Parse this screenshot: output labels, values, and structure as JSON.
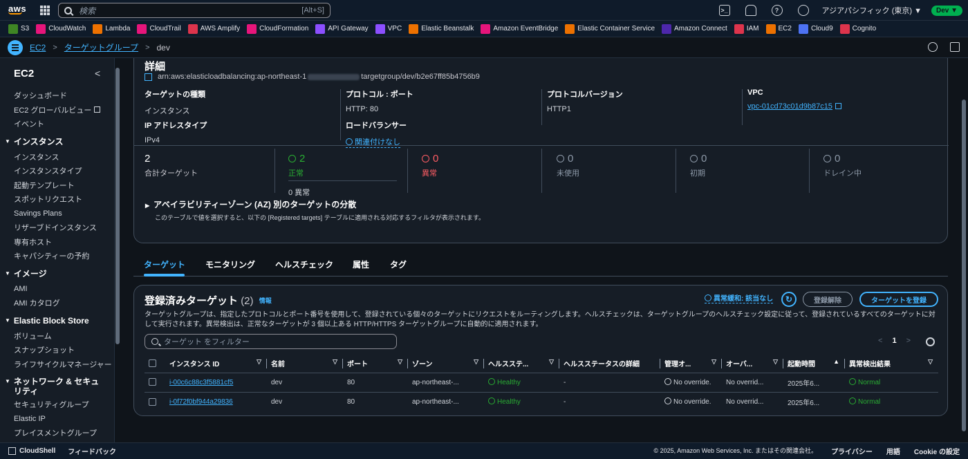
{
  "topbar": {
    "logo": "aws",
    "search_placeholder": "検索",
    "search_shortcut": "[Alt+S]",
    "region": "アジアパシフィック (東京) ▼",
    "account": "Dev ▼",
    "icons": [
      "cloudshell-icon",
      "bell-icon",
      "help-icon",
      "gear-icon"
    ]
  },
  "favorites": [
    {
      "label": "S3",
      "color": "#3f8624"
    },
    {
      "label": "CloudWatch",
      "color": "#e7157b"
    },
    {
      "label": "Lambda",
      "color": "#ed7100"
    },
    {
      "label": "CloudTrail",
      "color": "#e7157b"
    },
    {
      "label": "AWS Amplify",
      "color": "#dd344c"
    },
    {
      "label": "CloudFormation",
      "color": "#e7157b"
    },
    {
      "label": "API Gateway",
      "color": "#8c4fff"
    },
    {
      "label": "VPC",
      "color": "#8c4fff"
    },
    {
      "label": "Elastic Beanstalk",
      "color": "#ed7100"
    },
    {
      "label": "Amazon EventBridge",
      "color": "#e7157b"
    },
    {
      "label": "Elastic Container Service",
      "color": "#ed7100"
    },
    {
      "label": "Amazon Connect",
      "color": "#4d27aa"
    },
    {
      "label": "IAM",
      "color": "#dd344c"
    },
    {
      "label": "EC2",
      "color": "#ed7100"
    },
    {
      "label": "Cloud9",
      "color": "#4d72f3"
    },
    {
      "label": "Cognito",
      "color": "#dd344c"
    }
  ],
  "breadcrumb": {
    "items": [
      "EC2",
      "ターゲットグループ",
      "dev"
    ]
  },
  "sidebar": {
    "title": "EC2",
    "top_items": [
      "ダッシュボード",
      "EC2 グローバルビュー",
      "イベント"
    ],
    "sections": [
      {
        "title": "インスタンス",
        "items": [
          "インスタンス",
          "インスタンスタイプ",
          "起動テンプレート",
          "スポットリクエスト",
          "Savings Plans",
          "リザーブドインスタンス",
          "専有ホスト",
          "キャパシティーの予約"
        ]
      },
      {
        "title": "イメージ",
        "items": [
          "AMI",
          "AMI カタログ"
        ]
      },
      {
        "title": "Elastic Block Store",
        "items": [
          "ボリューム",
          "スナップショット",
          "ライフサイクルマネージャー"
        ]
      },
      {
        "title": "ネットワーク & セキュリティ",
        "items": [
          "セキュリティグループ",
          "Elastic IP",
          "プレイスメントグループ"
        ]
      }
    ]
  },
  "details": {
    "title": "詳細",
    "arn_prefix": "arn:aws:elasticloadbalancing:ap-northeast-1",
    "arn_suffix": "targetgroup/dev/b2e67ff85b4756b9",
    "target_type_label": "ターゲットの種類",
    "target_type_value": "インスタンス",
    "protocol_label": "プロトコル : ポート",
    "protocol_value": "HTTP: 80",
    "protocol_version_label": "プロトコルバージョン",
    "protocol_version_value": "HTTP1",
    "vpc_label": "VPC",
    "vpc_value": "vpc-01cd73c01d9b87c15",
    "ip_type_label": "IP アドレスタイプ",
    "ip_type_value": "IPv4",
    "lb_label": "ロードバランサー",
    "lb_value": "関連付けなし"
  },
  "stats": {
    "total": {
      "value": "2",
      "label": "合計ターゲット"
    },
    "healthy": {
      "value": "2",
      "label": "正常",
      "sub": "0 異常"
    },
    "unhealthy": {
      "value": "0",
      "label": "異常"
    },
    "unused": {
      "value": "0",
      "label": "未使用"
    },
    "initial": {
      "value": "0",
      "label": "初期"
    },
    "draining": {
      "value": "0",
      "label": "ドレイン中"
    }
  },
  "az": {
    "title": "アベイラビリティーゾーン (AZ) 別のターゲットの分散",
    "desc": "このテーブルで値を選択すると、以下の [Registered targets] テーブルに適用される対応するフィルタが表示されます。"
  },
  "tabs": [
    "ターゲット",
    "モニタリング",
    "ヘルスチェック",
    "属性",
    "タグ"
  ],
  "targets": {
    "title": "登録済みターゲット",
    "count": "(2)",
    "info": "情報",
    "desc": "ターゲットグループは、指定したプロトコルとポート番号を使用して、登録されている個々のターゲットにリクエストをルーティングします。ヘルスチェックは、ターゲットグループのヘルスチェック設定に従って、登録されているすべてのターゲットに対して実行されます。異常検出は、正常なターゲットが 3 個以上ある HTTP/HTTPS ターゲットグループに自動的に適用されます。",
    "anomaly": "異常緩和: 該当なし",
    "deregister": "登録解除",
    "register": "ターゲットを登録",
    "filter_placeholder": "ターゲット をフィルター",
    "page": "1",
    "columns": [
      "インスタンス ID",
      "名前",
      "ポート",
      "ゾーン",
      "ヘルスステ...",
      "ヘルスステータスの詳細",
      "管理オ...",
      "オーバ...",
      "起動時間",
      "異常検出結果"
    ],
    "rows": [
      {
        "id": "i-00c6c88c3f5881cf5",
        "name": "dev",
        "port": "80",
        "zone": "ap-northeast-...",
        "health": "Healthy",
        "detail": "-",
        "admin": "No override.",
        "override": "No overrid...",
        "launch": "2025年6...",
        "anomaly": "Normal"
      },
      {
        "id": "i-0f72f0bf944a29836",
        "name": "dev",
        "port": "80",
        "zone": "ap-northeast-...",
        "health": "Healthy",
        "detail": "-",
        "admin": "No override.",
        "override": "No overrid...",
        "launch": "2025年6...",
        "anomaly": "Normal"
      }
    ]
  },
  "footer": {
    "cloudshell": "CloudShell",
    "feedback": "フィードバック",
    "copyright": "© 2025, Amazon Web Services, Inc. またはその関連会社。",
    "privacy": "プライバシー",
    "terms": "用語",
    "cookie": "Cookie の設定"
  }
}
